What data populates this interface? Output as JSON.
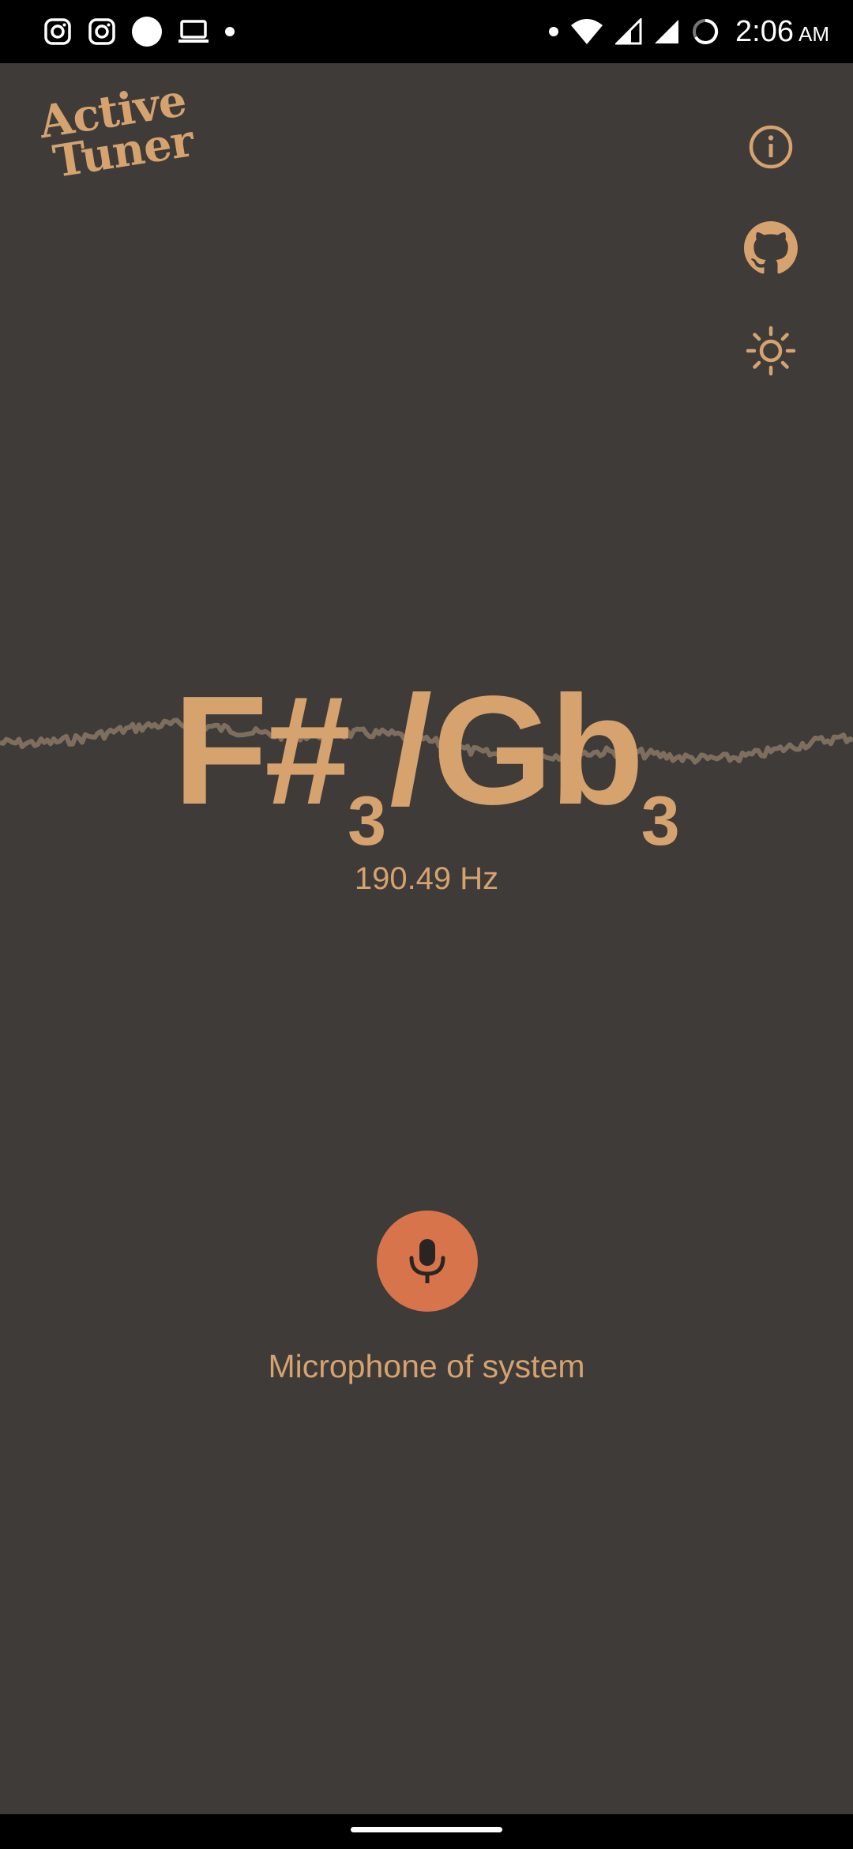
{
  "status_bar": {
    "time": "2:06",
    "ampm": "AM",
    "left_icons": [
      "instagram-icon",
      "instagram-icon",
      "circle-icon",
      "laptop-icon",
      "dot-icon"
    ],
    "right_icons": [
      "dot-icon",
      "wifi-icon",
      "signal-icon",
      "signal-icon",
      "battery-icon"
    ]
  },
  "header": {
    "logo_line1": "Active",
    "logo_line2": "Tuner",
    "icons": [
      "info-icon",
      "github-icon",
      "theme-sun-icon"
    ]
  },
  "tuner": {
    "note1": "F#",
    "octave1": "3",
    "separator": "/",
    "note2": "Gb",
    "octave2": "3",
    "frequency": "190.49 Hz"
  },
  "input": {
    "mic_icon": "microphone-icon",
    "label": "Microphone of system"
  },
  "colors": {
    "background": "#3e3b39",
    "accent": "#d6a26e",
    "mic_button": "#d7744b",
    "waveform": "#7e6e5e"
  }
}
